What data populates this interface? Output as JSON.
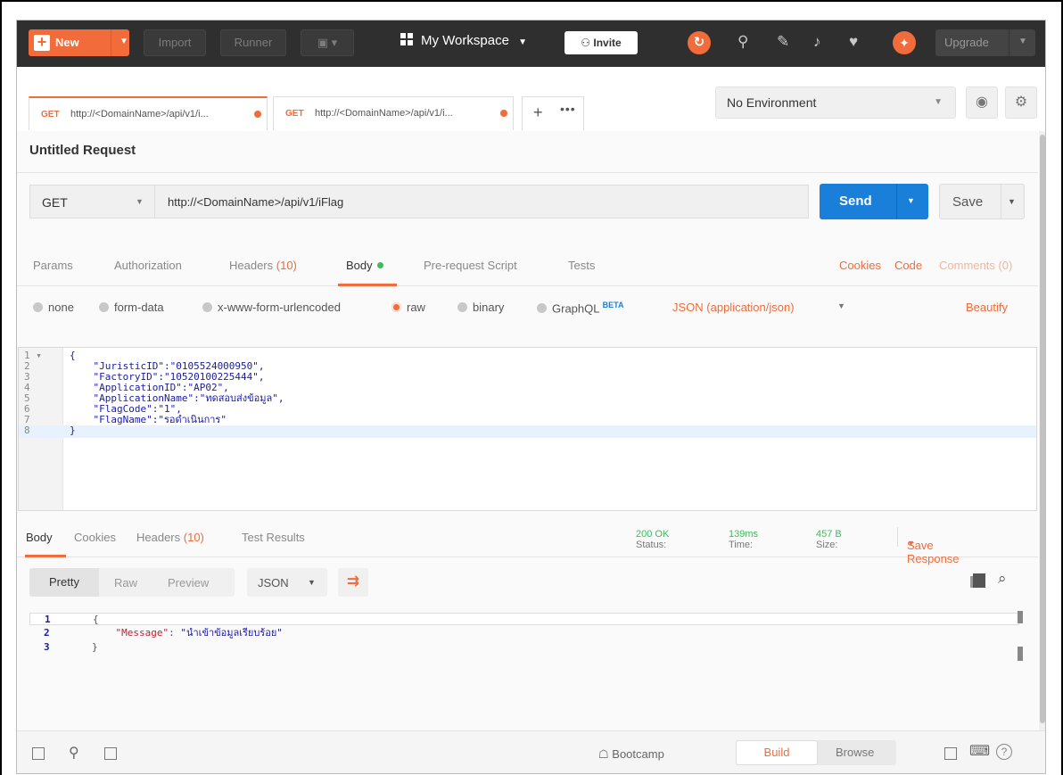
{
  "header": {
    "new_label": "New",
    "import_label": "Import",
    "runner_label": "Runner",
    "workspace_label": "My Workspace",
    "invite_label": "Invite",
    "upgrade_label": "Upgrade"
  },
  "tabs": [
    {
      "method": "GET",
      "url": "http://<DomainName>/api/v1/i..."
    },
    {
      "method": "GET",
      "url": "http://<DomainName>/api/v1/i..."
    }
  ],
  "environment": {
    "selected": "No Environment"
  },
  "request": {
    "title": "Untitled Request",
    "method": "GET",
    "url": "http://<DomainName>/api/v1/iFlag",
    "send_label": "Send",
    "save_label": "Save"
  },
  "request_tabs": {
    "params": "Params",
    "authorization": "Authorization",
    "headers": "Headers",
    "headers_count": "(10)",
    "body": "Body",
    "prerequest": "Pre-request Script",
    "tests": "Tests",
    "cookies": "Cookies",
    "code": "Code",
    "comments": "Comments (0)"
  },
  "body_types": {
    "none": "none",
    "form_data": "form-data",
    "urlencoded": "x-www-form-urlencoded",
    "raw": "raw",
    "binary": "binary",
    "graphql": "GraphQL",
    "beta": "BETA",
    "content_type": "JSON (application/json)",
    "beautify": "Beautify"
  },
  "request_body": {
    "lines": [
      {
        "n": "1 ▾",
        "code": "{"
      },
      {
        "n": "2",
        "code": "    \"JuristicID\":\"0105524000950\","
      },
      {
        "n": "3",
        "code": "    \"FactoryID\":\"10520100225444\","
      },
      {
        "n": "4",
        "code": "    \"ApplicationID\":\"AP02\","
      },
      {
        "n": "5",
        "code": "    \"ApplicationName\":\"ทดสอบส่งข้อมูล\","
      },
      {
        "n": "6",
        "code": "    \"FlagCode\":\"1\","
      },
      {
        "n": "7",
        "code": "    \"FlagName\":\"รอดำเนินการ\""
      },
      {
        "n": "8",
        "code": "}"
      }
    ]
  },
  "response": {
    "tabs": {
      "body": "Body",
      "cookies": "Cookies",
      "headers": "Headers",
      "headers_count": "(10)",
      "test_results": "Test Results"
    },
    "status_label": "Status:",
    "status_value": "200 OK",
    "time_label": "Time:",
    "time_value": "139ms",
    "size_label": "Size:",
    "size_value": "457 B",
    "save_response": "Save Response",
    "views": {
      "pretty": "Pretty",
      "raw": "Raw",
      "preview": "Preview"
    },
    "format": "JSON",
    "lines": [
      {
        "n": "1",
        "code": "{"
      },
      {
        "n": "2",
        "key": "\"Message\"",
        "value": "\"นำเข้าข้อมูลเรียบร้อย\""
      },
      {
        "n": "3",
        "code": "}"
      }
    ]
  },
  "statusbar": {
    "bootcamp": "Bootcamp",
    "build": "Build",
    "browse": "Browse",
    "help": "?"
  },
  "colors": {
    "accent": "#f26b3a",
    "send": "#1a7fd8",
    "ok": "#3cbc5c"
  }
}
